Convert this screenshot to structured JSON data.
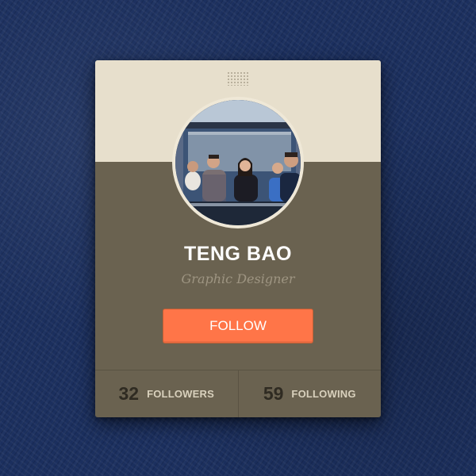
{
  "profile": {
    "name": "TENG BAO",
    "role": "Graphic Designer",
    "avatar_alt": "profile photo"
  },
  "actions": {
    "follow_label": "FOLLOW"
  },
  "stats": {
    "followers_count": "32",
    "followers_label": "FOLLOWERS",
    "following_count": "59",
    "following_label": "FOLLOWING"
  },
  "colors": {
    "page_background": "#1b2f5e",
    "card_header": "#e7dfcc",
    "card_body": "#6a6250",
    "follow_button": "#ff7548",
    "stat_number": "#2f2b22",
    "stat_label": "#d9d1bd"
  },
  "icons": {
    "grip": "drag-handle-dots"
  }
}
